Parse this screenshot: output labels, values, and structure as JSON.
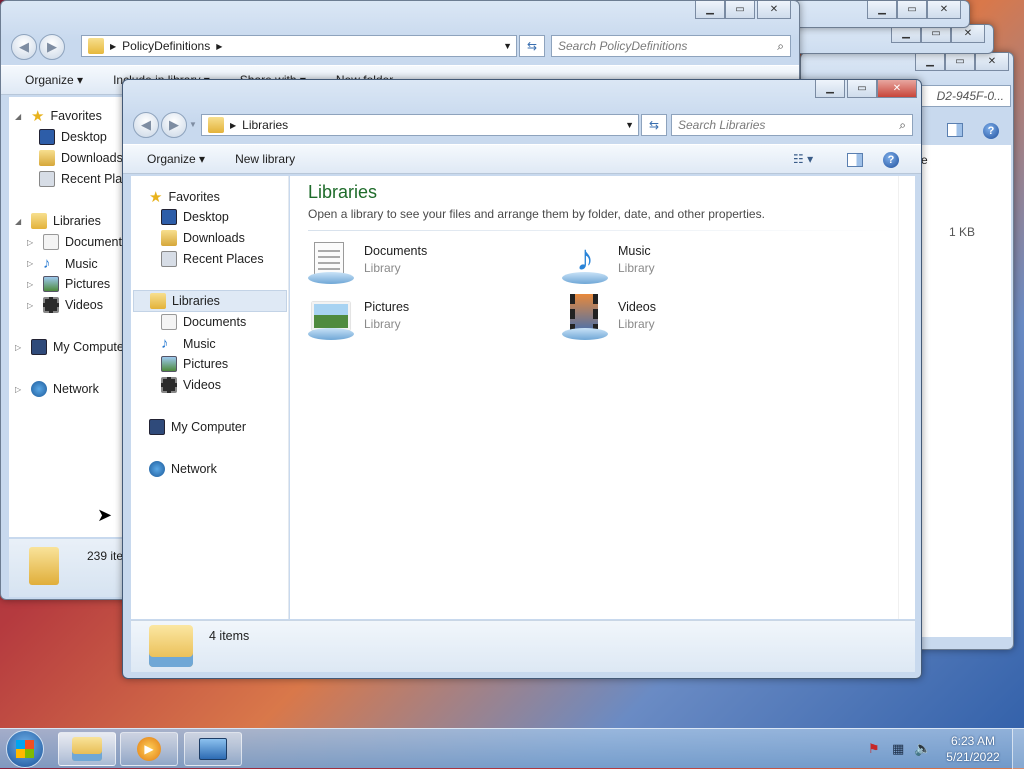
{
  "back_windows": {
    "policy": {
      "address": "PolicyDefinitions",
      "search_placeholder": "Search PolicyDefinitions",
      "toolbar": [
        "Organize",
        "Include in library",
        "Share with",
        "New folder"
      ],
      "nav": {
        "favorites": "Favorites",
        "fav_items": [
          "Desktop",
          "Downloads",
          "Recent Places"
        ],
        "libraries": "Libraries",
        "lib_items": [
          "Documents",
          "Music",
          "Pictures",
          "Videos"
        ],
        "computer": "My Computer",
        "network": "Network"
      },
      "status": "239 items"
    },
    "third": {
      "address_fragment": "D2-945F-0...",
      "column_fragment": "e",
      "size_text": "1 KB"
    }
  },
  "main": {
    "address": "Libraries",
    "search_placeholder": "Search Libraries",
    "toolbar": {
      "organize": "Organize",
      "new_library": "New library"
    },
    "nav": {
      "favorites": "Favorites",
      "fav_items": [
        "Desktop",
        "Downloads",
        "Recent Places"
      ],
      "libraries": "Libraries",
      "lib_items": [
        "Documents",
        "Music",
        "Pictures",
        "Videos"
      ],
      "computer": "My Computer",
      "network": "Network"
    },
    "heading": "Libraries",
    "subheading": "Open a library to see your files and arrange them by folder, date, and other properties.",
    "libraries": [
      {
        "name": "Documents",
        "type": "Library",
        "icon": "documents-library-icon"
      },
      {
        "name": "Music",
        "type": "Library",
        "icon": "music-library-icon"
      },
      {
        "name": "Pictures",
        "type": "Library",
        "icon": "pictures-library-icon"
      },
      {
        "name": "Videos",
        "type": "Library",
        "icon": "videos-library-icon"
      }
    ],
    "status": "4 items"
  },
  "taskbar": {
    "time": "6:23 AM",
    "date": "5/21/2022"
  },
  "colors": {
    "heading": "#1e6b2a",
    "accent": "#3a6fb0"
  }
}
